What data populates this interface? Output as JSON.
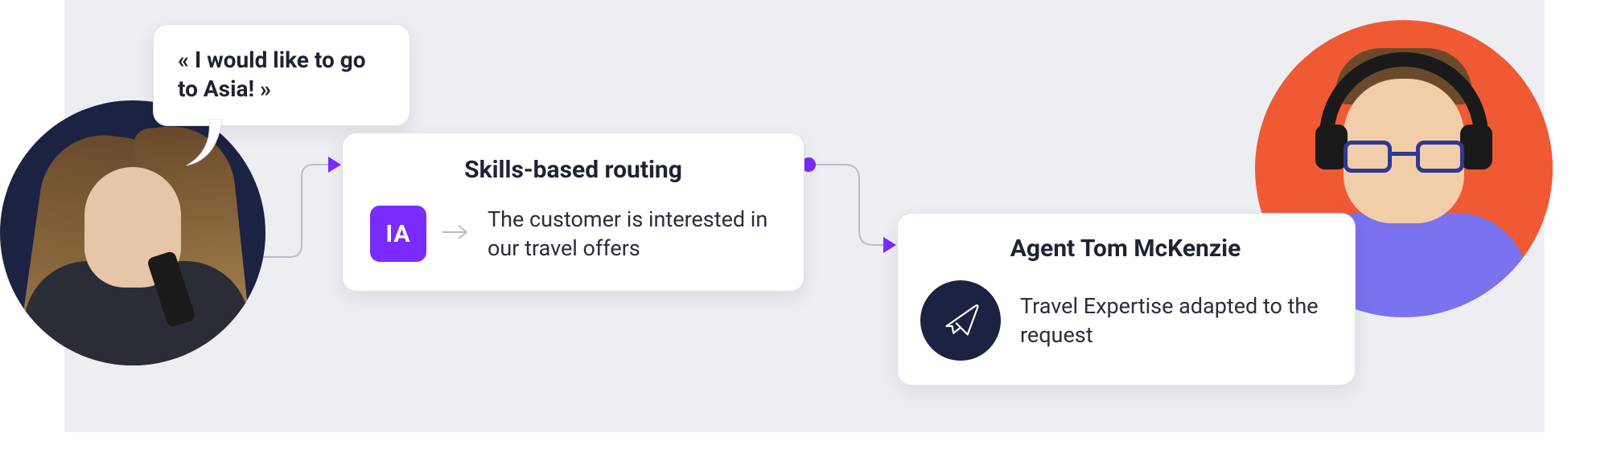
{
  "customer": {
    "quote": "« I would like to go to Asia! »"
  },
  "routing": {
    "title": "Skills-based routing",
    "ia_label": "IA",
    "insight": "The customer is interested in our travel offers"
  },
  "agent": {
    "title": "Agent Tom McKenzie",
    "skill_line": "Travel Expertise adapted to the request"
  },
  "icons": {
    "customer_avatar": "customer-avatar",
    "agent_avatar": "agent-avatar",
    "ai_badge": "ai-badge-icon",
    "plane": "plane-icon",
    "arrow_small": "arrow-right-icon"
  },
  "colors": {
    "accent_purple": "#7a2bff",
    "navy": "#1c2241",
    "agent_bg": "#ef5a34",
    "panel_bg": "#eceef2"
  }
}
